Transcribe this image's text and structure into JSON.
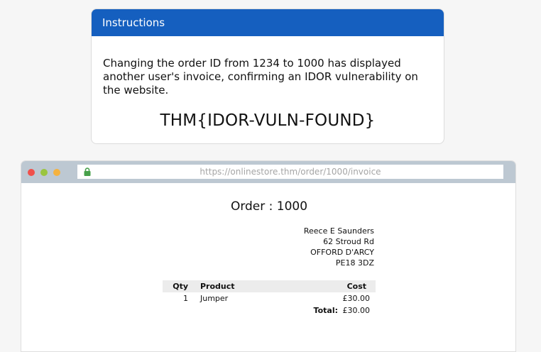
{
  "instructions": {
    "header": "Instructions",
    "message": "Changing the order ID from 1234 to 1000 has displayed another user's invoice, confirming an IDOR vulnerability on the website.",
    "flag": "THM{IDOR-VULN-FOUND}"
  },
  "browser": {
    "url": "https://onlinestore.thm/order/1000/invoice"
  },
  "invoice": {
    "title": "Order : 1000",
    "address": [
      "Reece E Saunders",
      "62 Stroud Rd",
      "OFFORD D'ARCY",
      "PE18 3DZ"
    ],
    "columns": {
      "qty": "Qty",
      "product": "Product",
      "cost": "Cost"
    },
    "items": [
      {
        "qty": "1",
        "product": "Jumper",
        "cost": "£30.00"
      }
    ],
    "total_label": "Total:",
    "total_value": "£30.00"
  },
  "colors": {
    "header_bg": "#155fbf",
    "browser_bar": "#bdc8d2",
    "lock": "#47a04a"
  }
}
